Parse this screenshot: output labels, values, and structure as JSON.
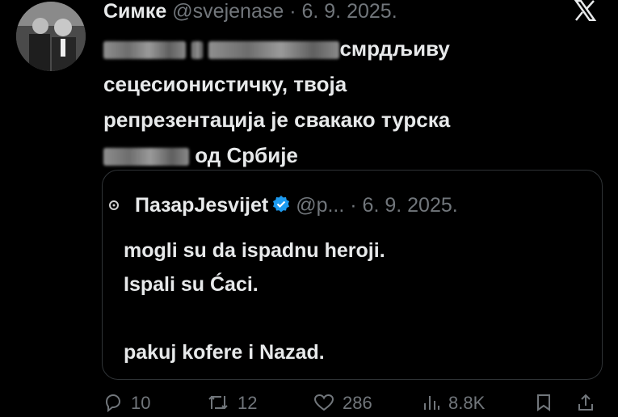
{
  "tweet": {
    "author_name": "Симке",
    "handle": "@svejenase",
    "separator": "·",
    "date": "6. 9. 2025.",
    "text_parts": [
      "смрдљиву",
      "сецесионистичку, твоја",
      "репрезентација је свакако турска",
      "од Србије"
    ]
  },
  "quote": {
    "author_name": "ПазарJesvijet",
    "handle": "@p...",
    "separator": "·",
    "date": "6. 9. 2025.",
    "body": "mogli su da ispadnu heroji.\nIspali su Ćaci.\n\npakuj kofere i Nazad."
  },
  "actions": {
    "replies": "10",
    "reposts": "12",
    "likes": "286",
    "views": "8.8K"
  },
  "icons": [
    "x-logo-icon",
    "verified-badge-icon",
    "reply-icon",
    "repost-icon",
    "like-icon",
    "views-icon",
    "bookmark-icon",
    "share-icon"
  ],
  "colors": {
    "background": "#000000",
    "text": "#e7e9ea",
    "muted": "#71767b",
    "verified": "#1d9bf0",
    "border": "#2f3336"
  }
}
